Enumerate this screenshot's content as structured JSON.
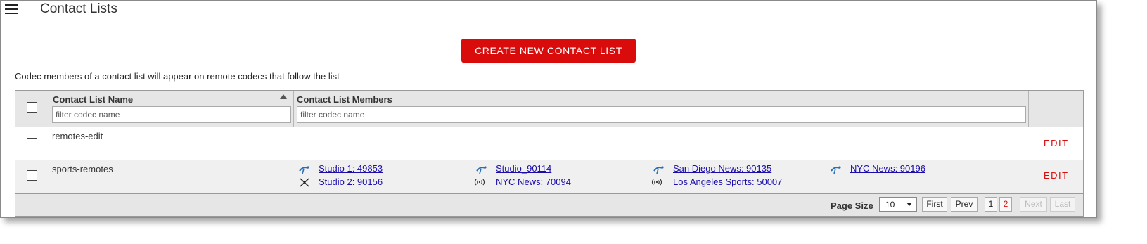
{
  "header": {
    "title": "Contact Lists",
    "menu_icon": "hamburger-menu-icon"
  },
  "create_button": {
    "label": "CREATE NEW CONTACT LIST"
  },
  "description": "Codec members of a contact list will appear on remote codecs that follow the list",
  "table": {
    "columns": {
      "name": "Contact List Name",
      "members": "Contact List Members"
    },
    "name_filter_placeholder": "filter codec name",
    "members_filter_placeholder": "filter codec name",
    "rows": [
      {
        "name": "remotes-edit",
        "edit_label": "EDIT"
      },
      {
        "name": "sports-remotes",
        "edit_label": "EDIT",
        "members": [
          {
            "label": "Studio 1: 49853",
            "icon": "satellite-dish-icon"
          },
          {
            "label": "Studio_90114",
            "icon": "satellite-dish-icon"
          },
          {
            "label": "San Diego News: 90135",
            "icon": "satellite-dish-icon"
          },
          {
            "label": "NYC News: 90196",
            "icon": "satellite-dish-icon"
          },
          {
            "label": "Studio 2: 90156",
            "icon": "crossed-antenna-icon"
          },
          {
            "label": "NYC News: 70094",
            "icon": "broadcast-signal-icon"
          },
          {
            "label": "Los Angeles Sports: 50007",
            "icon": "broadcast-signal-icon"
          }
        ]
      }
    ]
  },
  "pager": {
    "page_size_label": "Page Size",
    "page_size_value": "10",
    "first_label": "First",
    "prev_label": "Prev",
    "pages": [
      "1",
      "2"
    ],
    "next_label": "Next",
    "last_label": "Last"
  },
  "colors": {
    "accent": "#d90b0b",
    "link": "#1a0dab"
  }
}
